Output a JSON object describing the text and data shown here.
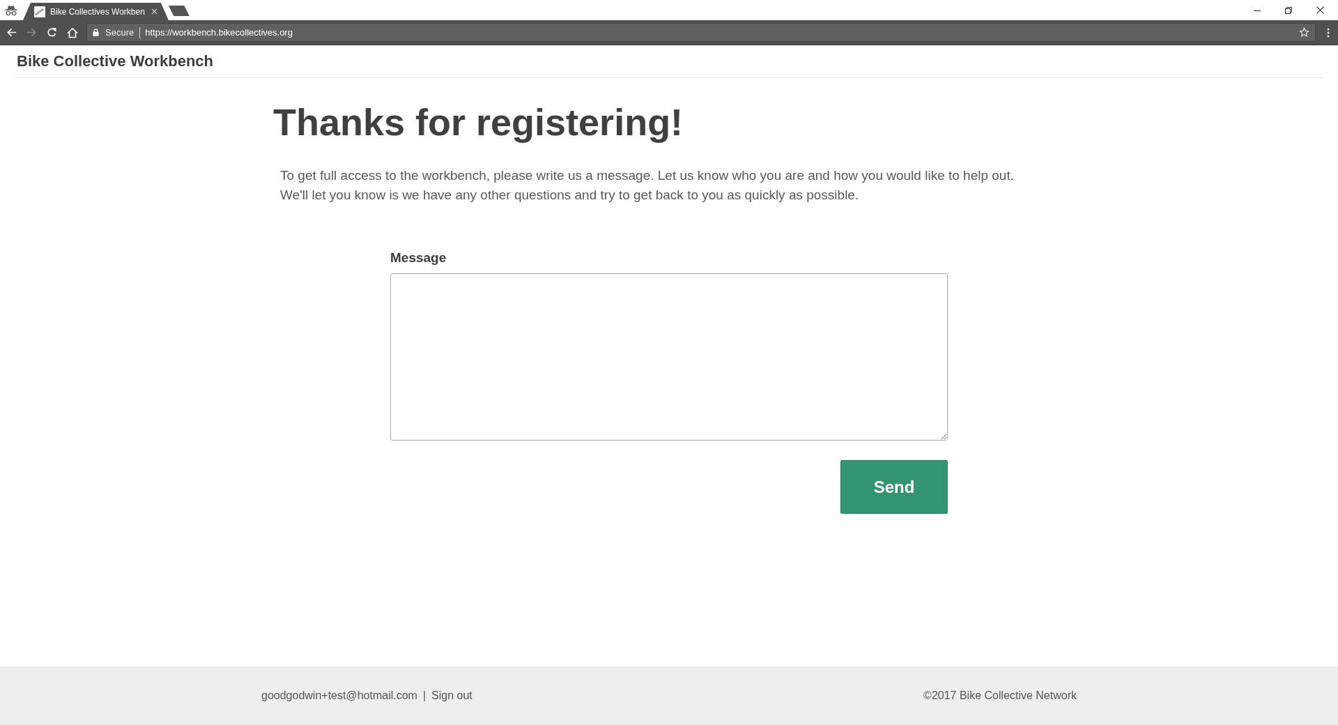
{
  "browser": {
    "tabs": [
      {
        "title": "Bike Collectives Workben",
        "selected": true
      }
    ],
    "forward_disabled": true,
    "security_label": "Secure",
    "url": "https://workbench.bikecollectives.org"
  },
  "header": {
    "site_title": "Bike Collective Workbench"
  },
  "main": {
    "heading": "Thanks for registering!",
    "intro_lines": [
      "To get full access to the workbench, please write us a message. Let us know who you are and how you would like to help out.",
      "We'll let you know is we have any other questions and try to get back to you as quickly as possible."
    ],
    "form": {
      "message_label": "Message",
      "send_button": "Send"
    }
  },
  "footer": {
    "user_email": "goodgodwin+test@hotmail.com",
    "separator": "|",
    "sign_out": "Sign out",
    "copyright": "©2017 Bike Collective Network"
  }
}
